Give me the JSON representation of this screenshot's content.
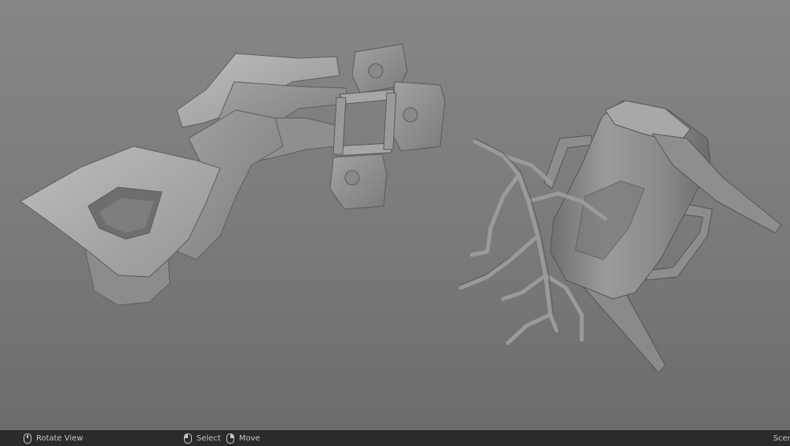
{
  "status_bar": {
    "hints": [
      {
        "label": "Rotate View",
        "icon": "mouse-middle-icon"
      },
      {
        "label": "Select",
        "icon": "mouse-left-icon"
      },
      {
        "label": "Move",
        "icon": "mouse-right-icon"
      }
    ],
    "right_text": "Scen"
  },
  "colors": {
    "viewport_top": "#868686",
    "viewport_bottom": "#6c6c6c",
    "status_bar_bg": "#2b2b2b",
    "mesh_light": "#a9a9a9",
    "mesh_dark": "#6a6a6a"
  }
}
